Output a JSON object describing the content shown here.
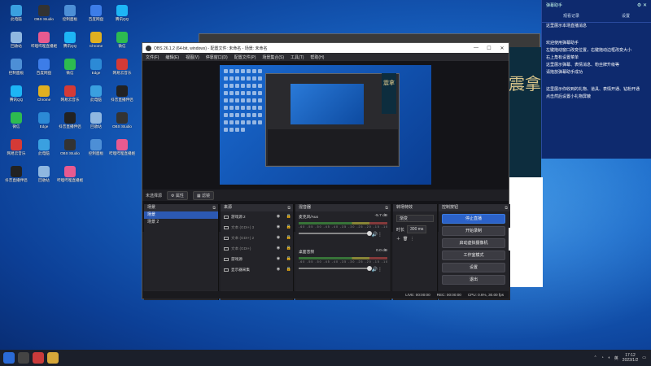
{
  "desktop": {
    "icons": [
      {
        "label": "此电脑",
        "color": "#3aa0e0"
      },
      {
        "label": "回收站",
        "color": "#8fb7e0"
      },
      {
        "label": "控制面板",
        "color": "#4d8fd6"
      },
      {
        "label": "腾讯QQ",
        "color": "#1db5f5"
      },
      {
        "label": "微信",
        "color": "#2dbb50"
      },
      {
        "label": "网易云音乐",
        "color": "#d43a36"
      },
      {
        "label": "抖音直播伴侣",
        "color": "#222222"
      },
      {
        "label": "OBS Studio",
        "color": "#333333"
      },
      {
        "label": "哔哩哔哩直播姬",
        "color": "#e85a90"
      },
      {
        "label": "百度网盘",
        "color": "#3d7de8"
      },
      {
        "label": "Chrome",
        "color": "#e0b020"
      },
      {
        "label": "Edge",
        "color": "#2c8ad6"
      }
    ]
  },
  "obs": {
    "title": "OBS 26.1.2 (64-bit, windows) - 配置文件: 未命名 - 场景: 未命名",
    "menu": [
      "文件(F)",
      "编辑(E)",
      "视图(V)",
      "停靠窗口(D)",
      "配置文件(P)",
      "场景集合(S)",
      "工具(T)",
      "帮助(H)"
    ],
    "preview_label": "未选择源",
    "properties_btn": "属性",
    "filters_btn": "滤镜",
    "docks": {
      "scenes": {
        "title": "场景",
        "items": [
          "场景",
          "场景 2"
        ]
      },
      "sources": {
        "title": "来源",
        "items": [
          {
            "label": "游戏源 2",
            "dim": false
          },
          {
            "label": "文本 (GDI+) 3",
            "dim": true
          },
          {
            "label": "文本 (GDI+) 2",
            "dim": true
          },
          {
            "label": "文本 (GDI+)",
            "dim": true
          },
          {
            "label": "游戏源",
            "dim": false
          },
          {
            "label": "显示器采集",
            "dim": false
          }
        ]
      },
      "mixer": {
        "title": "混音器",
        "channels": [
          {
            "name": "麦克风/Aux",
            "db": "-5.7 dB"
          },
          {
            "name": "桌面音频",
            "db": "0.0 dB"
          }
        ],
        "scale": "-60 -55 -50 -45 -40 -35 -30 -25 -20 -15 -10 -5 0"
      },
      "transitions": {
        "title": "转场特效",
        "selected": "渐变",
        "duration_label": "时长",
        "duration": "300 ms"
      },
      "controls": {
        "title": "控制按钮",
        "buttons": [
          "停止直播",
          "开始录制",
          "启动虚拟摄像机",
          "工作室模式",
          "设置",
          "退出"
        ]
      }
    },
    "status": {
      "live": "LIVE: 00:00:00",
      "rec": "REC: 00:00:00",
      "cpu": "CPU: 0.6%, 30.00 fps"
    }
  },
  "chat": {
    "title": "弹幕助手",
    "tabs": [
      "观看记录",
      "设置"
    ],
    "messages": [
      "这里展示本场直播消息",
      "",
      "欢迎使用弹幕助手",
      "左键拖动窗口改变位置，右键拖动边框改变大小",
      "右上角有设置菜单",
      "这里展示弹幕、表情消息、粉丝牌升级等",
      "请拖放弹幕助手成功",
      "",
      "这里展示你收到的礼物、道具、表情开通、钻粉开通",
      "点击然后设置小礼物屏蔽"
    ]
  },
  "background_window": {
    "calligraphy": "震拿"
  },
  "taskbar": {
    "time": "17:12",
    "date": "2023/1/2",
    "lang": "英"
  }
}
